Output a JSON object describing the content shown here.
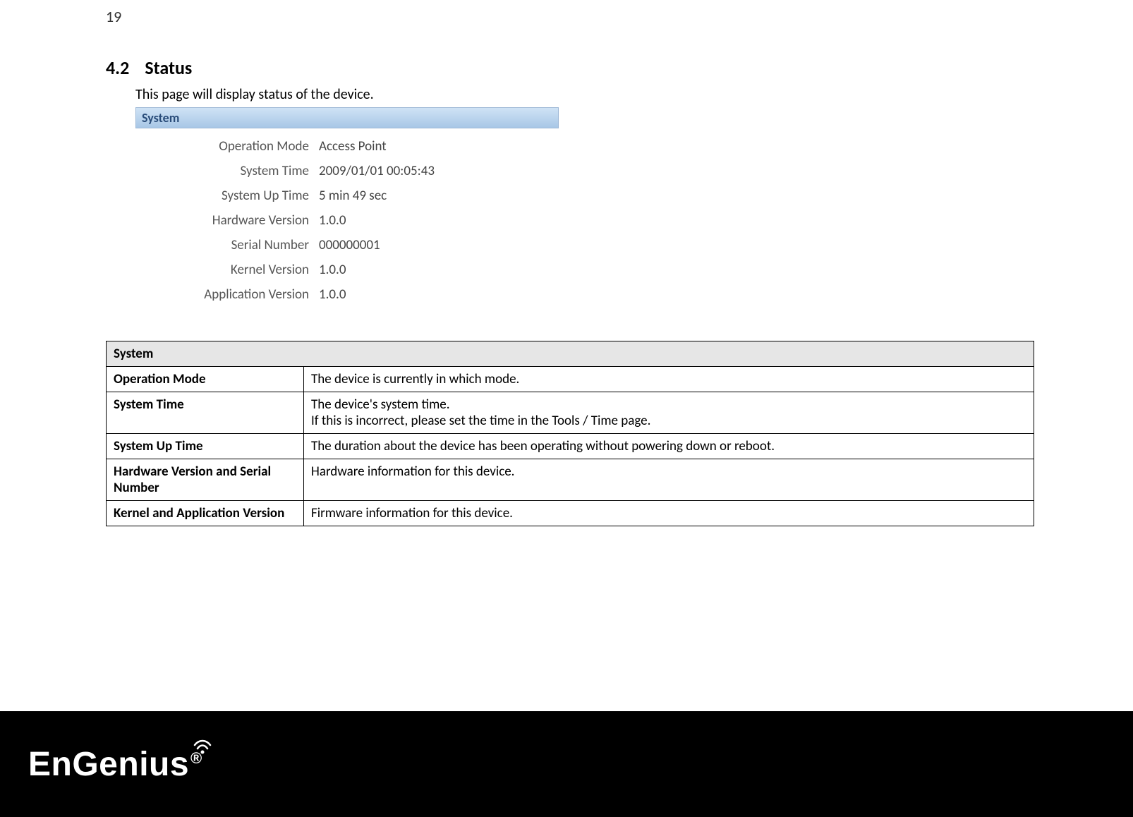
{
  "page_number": "19",
  "heading": {
    "number": "4.2",
    "title": "Status"
  },
  "intro": "This page will display status of the device.",
  "status_panel": {
    "header": "System",
    "rows": [
      {
        "label": "Operation Mode",
        "value": "Access Point"
      },
      {
        "label": "System Time",
        "value": "2009/01/01 00:05:43"
      },
      {
        "label": "System Up Time",
        "value": "5 min 49 sec"
      },
      {
        "label": "Hardware Version",
        "value": "1.0.0"
      },
      {
        "label": "Serial Number",
        "value": "000000001"
      },
      {
        "label": "Kernel Version",
        "value": "1.0.0"
      },
      {
        "label": "Application Version",
        "value": "1.0.0"
      }
    ]
  },
  "info_table": {
    "header": "System",
    "rows": [
      {
        "label": "Operation Mode",
        "desc": "The device is currently in which mode."
      },
      {
        "label": "System Time",
        "desc": "The device's system time.\nIf this is incorrect, please set the time in the Tools / Time page."
      },
      {
        "label": "System Up Time",
        "desc": "The duration about the device has been operating without powering down or reboot."
      },
      {
        "label": "Hardware Version and Serial Number",
        "desc": "Hardware information for this device."
      },
      {
        "label": "Kernel and Application Version",
        "desc": "Firmware information for this device."
      }
    ]
  },
  "logo_text": "EnGenius",
  "logo_reg": "®"
}
